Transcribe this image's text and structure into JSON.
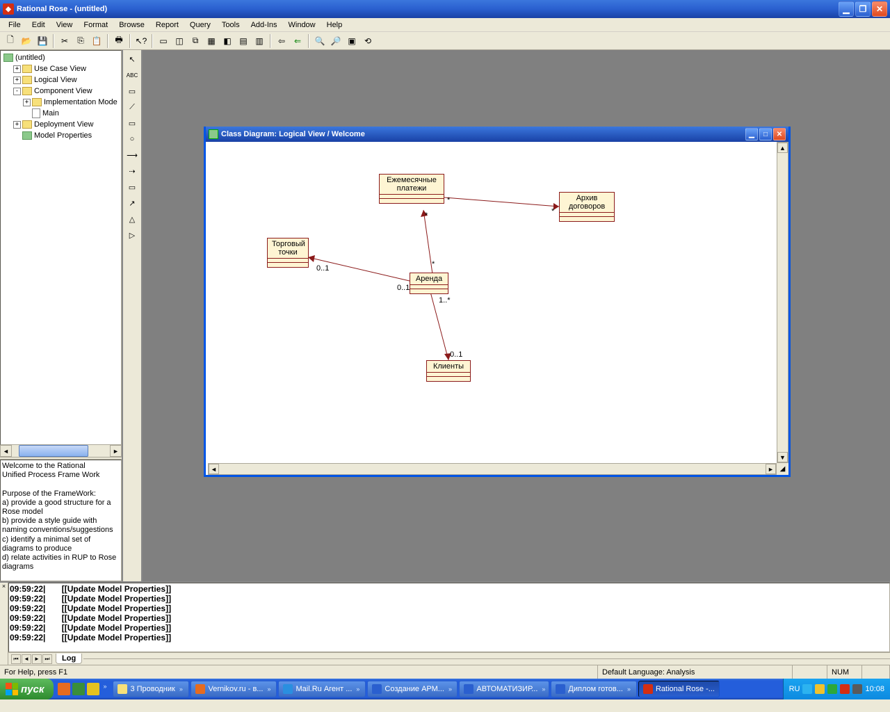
{
  "titlebar": {
    "title": "Rational Rose - (untitled)"
  },
  "menu": [
    "File",
    "Edit",
    "View",
    "Format",
    "Browse",
    "Report",
    "Query",
    "Tools",
    "Add-Ins",
    "Window",
    "Help"
  ],
  "tree": {
    "root": "(untitled)",
    "items": [
      {
        "label": "Use Case View",
        "exp": "+",
        "indent": 1,
        "icon": "folder"
      },
      {
        "label": "Logical View",
        "exp": "+",
        "indent": 1,
        "icon": "folder"
      },
      {
        "label": "Component View",
        "exp": "-",
        "indent": 1,
        "icon": "folder"
      },
      {
        "label": "Implementation Mode",
        "exp": "+",
        "indent": 2,
        "icon": "folder"
      },
      {
        "label": "Main",
        "exp": "",
        "indent": 2,
        "icon": "doc"
      },
      {
        "label": "Deployment View",
        "exp": "+",
        "indent": 1,
        "icon": "folder"
      },
      {
        "label": "Model Properties",
        "exp": "",
        "indent": 1,
        "icon": "pkg"
      }
    ]
  },
  "doc_text": "Welcome to the Rational\nUnified Process Frame Work\n\nPurpose of the FrameWork:\na) provide a good structure for a Rose model\nb) provide a style guide with naming conventions/suggestions\nc) identify a minimal set of diagrams to produce\nd) relate activities in RUP to Rose diagrams",
  "child": {
    "title": "Class Diagram: Logical View / Welcome",
    "classes": {
      "c1": "Ежемесячные\nплатежи",
      "c2": "Архив договоров",
      "c3": "Торговый точки",
      "c4": "Аренда",
      "c5": "Клиенты"
    },
    "mult": {
      "m1": "*",
      "m2": "*",
      "m3": "*",
      "m4": "0..1",
      "m5": "*",
      "m6": "0..1",
      "m7": "1..*",
      "m8": "0..1"
    }
  },
  "log": {
    "entries": [
      {
        "time": "09:59:22",
        "msg": "[[Update Model Properties]]"
      },
      {
        "time": "09:59:22",
        "msg": "[[Update Model Properties]]"
      },
      {
        "time": "09:59:22",
        "msg": "[[Update Model Properties]]"
      },
      {
        "time": "09:59:22",
        "msg": "[[Update Model Properties]]"
      },
      {
        "time": "09:59:22",
        "msg": "[[Update Model Properties]]"
      },
      {
        "time": "09:59:22",
        "msg": "[[Update Model Properties]]"
      }
    ],
    "tab": "Log"
  },
  "status": {
    "hint": "For Help, press F1",
    "lang": "Default Language: Analysis",
    "num": "NUM"
  },
  "taskbar": {
    "start": "пуск",
    "tasks": [
      {
        "label": "3 Проводник",
        "color": "#f7e07a"
      },
      {
        "label": "Vernikov.ru - в...",
        "color": "#e66b1f"
      },
      {
        "label": "Mail.Ru Агент ...",
        "color": "#2a8fe0"
      },
      {
        "label": "Создание АРМ...",
        "color": "#2a5fcf"
      },
      {
        "label": "АВТОМАТИЗИР...",
        "color": "#2a5fcf"
      },
      {
        "label": "Диплом готов...",
        "color": "#2a5fcf"
      },
      {
        "label": "Rational Rose -...",
        "color": "#d42e12",
        "active": true
      }
    ],
    "lang_ind": "RU",
    "clock": "10:08"
  }
}
